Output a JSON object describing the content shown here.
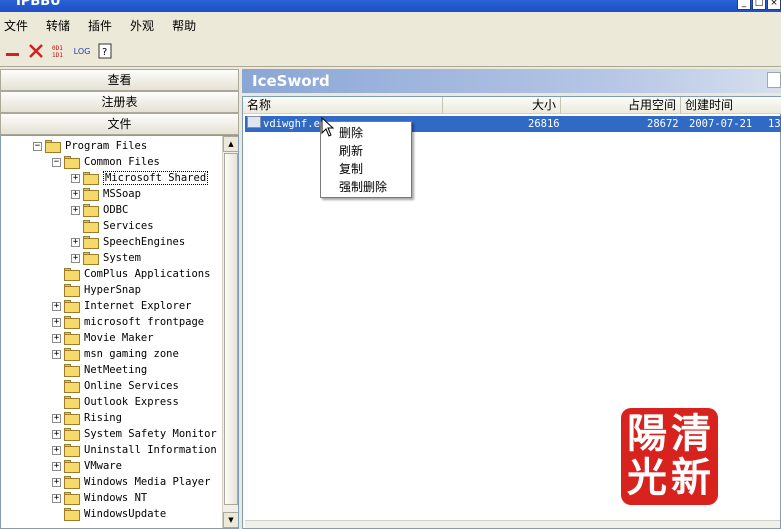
{
  "window": {
    "title": "IPBBU"
  },
  "menu": [
    "文件",
    "转储",
    "插件",
    "外观",
    "帮助"
  ],
  "toolbar": {
    "icons": [
      "minus-icon",
      "close-x-icon",
      "binary-icon",
      "log-icon",
      "help-icon"
    ],
    "log_label": "LOG"
  },
  "nav": {
    "view": "查看",
    "registry": "注册表",
    "file": "文件"
  },
  "tree": [
    {
      "label": "Program Files",
      "indent": 0,
      "expander": "−"
    },
    {
      "label": "Common Files",
      "indent": 1,
      "expander": "−"
    },
    {
      "label": "Microsoft Shared",
      "indent": 2,
      "expander": "+",
      "selected": true
    },
    {
      "label": "MSSoap",
      "indent": 2,
      "expander": "+"
    },
    {
      "label": "ODBC",
      "indent": 2,
      "expander": "+"
    },
    {
      "label": "Services",
      "indent": 2,
      "expander": ""
    },
    {
      "label": "SpeechEngines",
      "indent": 2,
      "expander": "+"
    },
    {
      "label": "System",
      "indent": 2,
      "expander": "+"
    },
    {
      "label": "ComPlus Applications",
      "indent": 1,
      "expander": ""
    },
    {
      "label": "HyperSnap",
      "indent": 1,
      "expander": ""
    },
    {
      "label": "Internet Explorer",
      "indent": 1,
      "expander": "+"
    },
    {
      "label": "microsoft frontpage",
      "indent": 1,
      "expander": "+"
    },
    {
      "label": "Movie Maker",
      "indent": 1,
      "expander": "+"
    },
    {
      "label": "msn gaming zone",
      "indent": 1,
      "expander": "+"
    },
    {
      "label": "NetMeeting",
      "indent": 1,
      "expander": ""
    },
    {
      "label": "Online Services",
      "indent": 1,
      "expander": ""
    },
    {
      "label": "Outlook Express",
      "indent": 1,
      "expander": ""
    },
    {
      "label": "Rising",
      "indent": 1,
      "expander": "+"
    },
    {
      "label": "System Safety Monitor",
      "indent": 1,
      "expander": "+"
    },
    {
      "label": "Uninstall Information",
      "indent": 1,
      "expander": "+"
    },
    {
      "label": "VMware",
      "indent": 1,
      "expander": "+"
    },
    {
      "label": "Windows Media Player",
      "indent": 1,
      "expander": "+"
    },
    {
      "label": "Windows NT",
      "indent": 1,
      "expander": "+"
    },
    {
      "label": "WindowsUpdate",
      "indent": 1,
      "expander": ""
    }
  ],
  "panel": {
    "title": "IceSword"
  },
  "columns": {
    "name": "名称",
    "size": "大小",
    "space": "占用空间",
    "created": "创建时间"
  },
  "file_row": {
    "name": "vdiwghf.ex",
    "size": "26816",
    "space": "28672",
    "created": "2007-07-21",
    "extra": "13"
  },
  "context_menu": [
    "删除",
    "刷新",
    "复制",
    "强制删除"
  ],
  "seal": {
    "chars": [
      "清",
      "陽",
      "新",
      "光"
    ],
    "color": "#d8221e"
  }
}
